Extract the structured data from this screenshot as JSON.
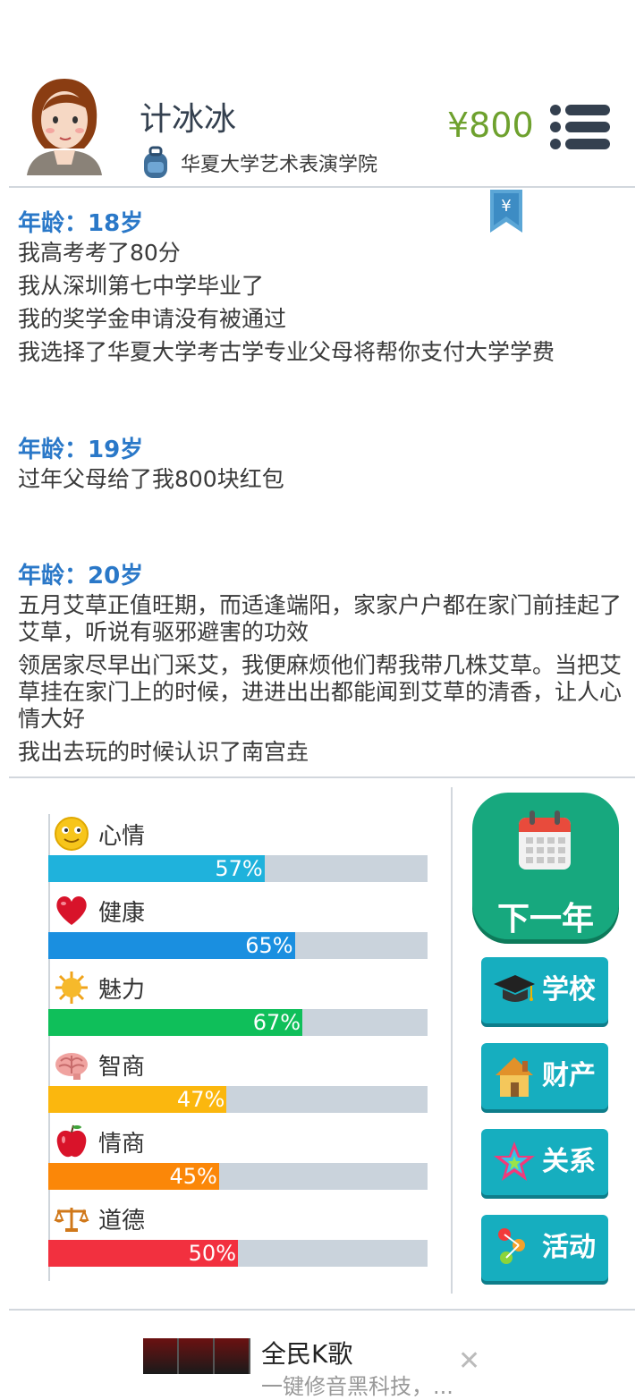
{
  "header": {
    "name": "计冰冰",
    "school": "华夏大学艺术表演学院",
    "money": "¥800",
    "colors": {
      "money": "#6ea12e",
      "name": "#34404f"
    }
  },
  "log": {
    "bookmark_symbol": "¥",
    "entries": [
      {
        "age": "年龄：18岁",
        "lines": [
          "我高考考了80分",
          "我从深圳第七中学毕业了",
          "我的奖学金申请没有被通过",
          "我选择了华夏大学考古学专业父母将帮你支付大学学费"
        ]
      },
      {
        "age": "年龄：19岁",
        "lines": [
          "过年父母给了我800块红包"
        ]
      },
      {
        "age": "年龄：20岁",
        "lines": [
          "五月艾草正值旺期，而适逢端阳，家家户户都在家门前挂起了艾草，听说有驱邪避害的功效",
          "领居家尽早出门采艾，我便麻烦他们帮我带几株艾草。当把艾草挂在家门上的时候，进进出出都能闻到艾草的清香，让人心情大好",
          "我出去玩的时候认识了南宫垚"
        ]
      }
    ]
  },
  "stats": [
    {
      "label": "心情",
      "value": 57,
      "text": "57%",
      "color": "#1fb2dc",
      "icon": "smiley-icon"
    },
    {
      "label": "健康",
      "value": 65,
      "text": "65%",
      "color": "#1a8fe0",
      "icon": "heart-icon"
    },
    {
      "label": "魅力",
      "value": 67,
      "text": "67%",
      "color": "#0fbf5a",
      "icon": "sun-icon"
    },
    {
      "label": "智商",
      "value": 47,
      "text": "47%",
      "color": "#fbb70e",
      "icon": "brain-icon"
    },
    {
      "label": "情商",
      "value": 45,
      "text": "45%",
      "color": "#fb8708",
      "icon": "apple-icon"
    },
    {
      "label": "道德",
      "value": 50,
      "text": "50%",
      "color": "#f2303f",
      "icon": "scales-icon"
    }
  ],
  "actions": {
    "next_year": "下一年",
    "school": "学校",
    "property": "财产",
    "relations": "关系",
    "activities": "活动"
  },
  "ad": {
    "title": "全民K歌",
    "subtitle": "一键修音黑科技，...",
    "close": "✕"
  }
}
